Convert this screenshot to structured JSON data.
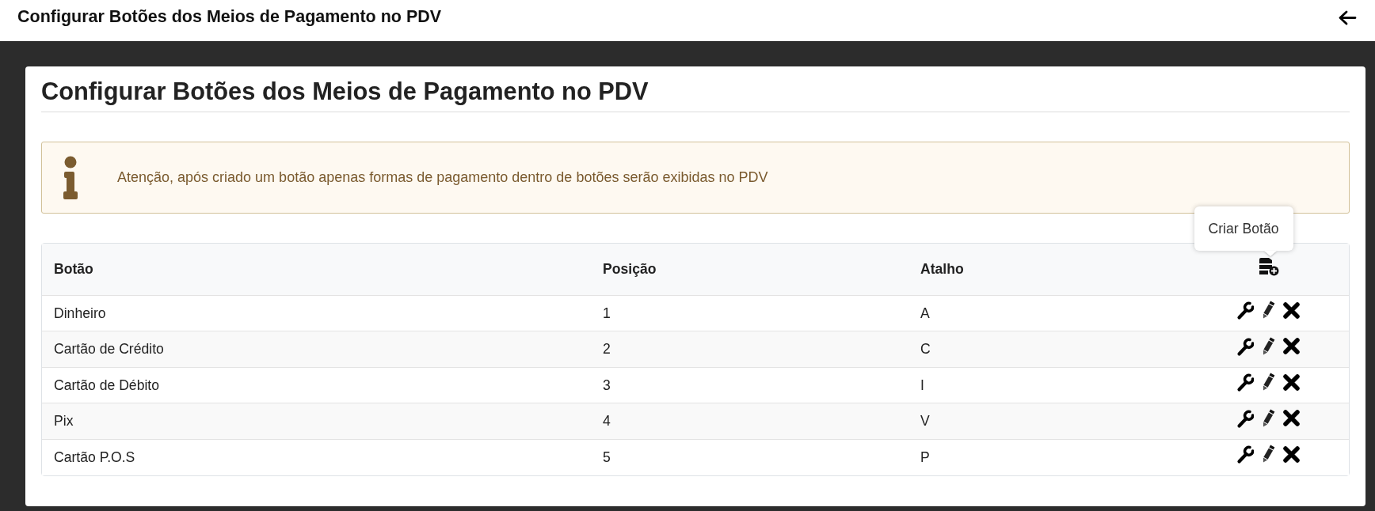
{
  "top_bar": {
    "title": "Configurar Botões dos Meios de Pagamento no PDV"
  },
  "page": {
    "heading": "Configurar Botões dos Meios de Pagamento no PDV"
  },
  "alert": {
    "text": "Atenção, após criado um botão apenas formas de pagamento dentro de botões serão exibidas no PDV"
  },
  "table": {
    "columns": [
      "Botão",
      "Posição",
      "Atalho"
    ],
    "tooltip": "Criar Botão",
    "rows": [
      {
        "cells": [
          "Dinheiro",
          "1",
          "A"
        ]
      },
      {
        "cells": [
          "Cartão de Crédito",
          "2",
          "C"
        ]
      },
      {
        "cells": [
          "Cartão de Débito",
          "3",
          "I"
        ]
      },
      {
        "cells": [
          "Pix",
          "4",
          "V"
        ]
      },
      {
        "cells": [
          "Cartão P.O.S",
          "5",
          "P"
        ]
      }
    ]
  }
}
